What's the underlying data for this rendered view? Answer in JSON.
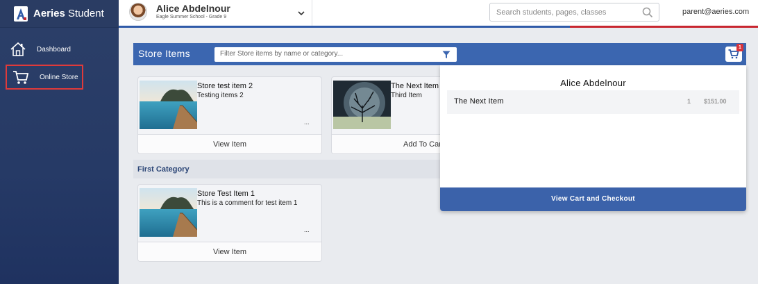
{
  "app": {
    "brand_bold": "Aeries",
    "brand_light": "Student",
    "accent": "#3b66b0",
    "alert": "#d9333a"
  },
  "sidebar": {
    "items": [
      {
        "label": "Dashboard",
        "icon": "home-icon"
      },
      {
        "label": "Online Store",
        "icon": "cart-icon",
        "highlighted": true
      }
    ]
  },
  "header": {
    "student_name": "Alice Abdelnour",
    "student_sub": "Eagle Summer School - Grade 9",
    "search_placeholder": "Search students, pages, classes",
    "user_email": "parent@aeries.com"
  },
  "store": {
    "title": "Store Items",
    "filter_placeholder": "Filter Store items by name or category...",
    "cart_count": "1",
    "items": [
      {
        "title": "Store test item 2",
        "desc": "Testing items 2",
        "more": "...",
        "action": "View Item"
      },
      {
        "title": "The Next Item",
        "desc": "Third Item",
        "action": "Add To Cart"
      }
    ],
    "category": "First Category",
    "category_items": [
      {
        "title": "Store Test Item 1",
        "desc": "This is a comment for test item 1",
        "more": "...",
        "action": "View Item"
      }
    ]
  },
  "cart_popup": {
    "student": "Alice Abdelnour",
    "lines": [
      {
        "name": "The Next Item",
        "qty": "1",
        "price": "$151.00"
      }
    ],
    "checkout_label": "View Cart and Checkout"
  }
}
